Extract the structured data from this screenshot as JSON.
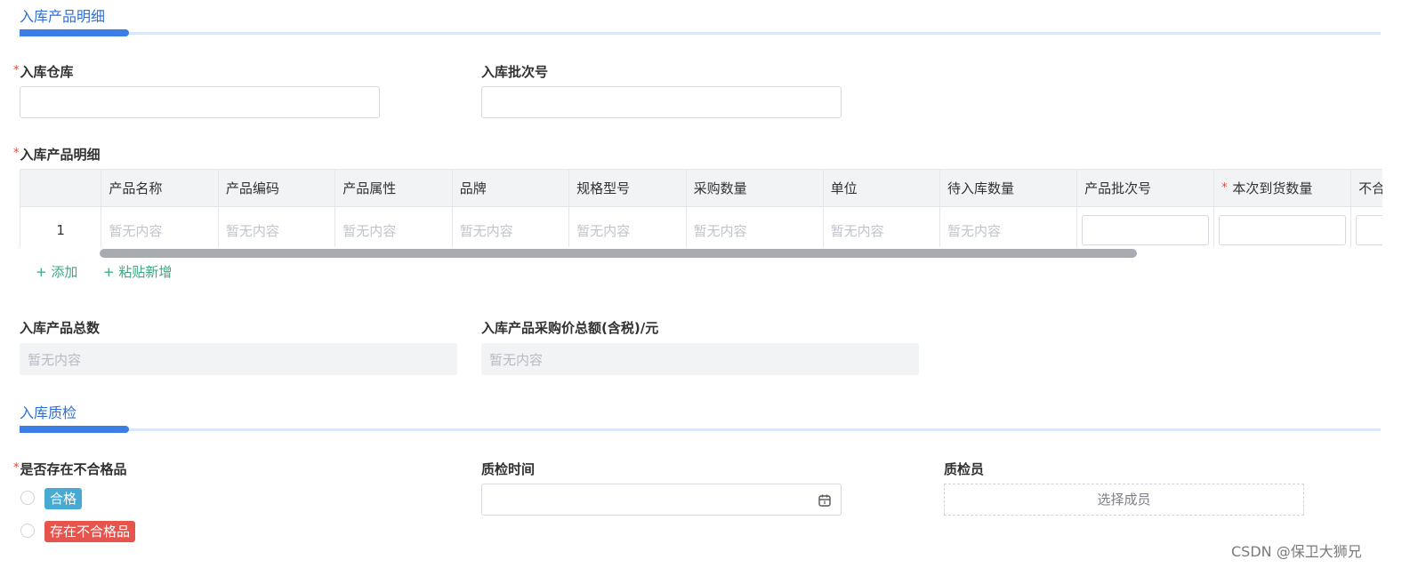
{
  "section_inbound": {
    "title": "入库产品明细"
  },
  "fields": {
    "warehouse": {
      "label": "入库仓库",
      "required_mark": "*",
      "value": ""
    },
    "batch_no": {
      "label": "入库批次号",
      "value": ""
    }
  },
  "product_table": {
    "label": "入库产品明细",
    "required_mark": "*",
    "columns": [
      "产品名称",
      "产品编码",
      "产品属性",
      "品牌",
      "规格型号",
      "采购数量",
      "单位",
      "待入库数量",
      "产品批次号",
      "本次到货数量",
      "不合格数"
    ],
    "required_column_mark": "*",
    "rows": [
      {
        "index": "1",
        "cells": [
          "暂无内容",
          "暂无内容",
          "暂无内容",
          "暂无内容",
          "暂无内容",
          "暂无内容",
          "暂无内容",
          "暂无内容"
        ]
      }
    ],
    "add_label": "+ 添加",
    "paste_label": "+ 粘贴新增"
  },
  "totals": {
    "count": {
      "label": "入库产品总数",
      "value": "暂无内容"
    },
    "amount": {
      "label": "入库产品采购价总额(含税)/元",
      "value": "暂无内容"
    }
  },
  "section_qc": {
    "title": "入库质检"
  },
  "qc": {
    "has_defect": {
      "label": "是否存在不合格品",
      "required_mark": "*",
      "options": [
        {
          "label": "合格",
          "color": "#48a9d3"
        },
        {
          "label": "存在不合格品",
          "color": "#e5544d"
        }
      ]
    },
    "time": {
      "label": "质检时间",
      "value": "",
      "icon": "calendar-icon"
    },
    "inspector": {
      "label": "质检员",
      "button": "选择成员"
    }
  },
  "watermark": "CSDN @保卫大狮兄",
  "colors": {
    "accent": "#3d7ee6",
    "link": "#3aa880"
  }
}
